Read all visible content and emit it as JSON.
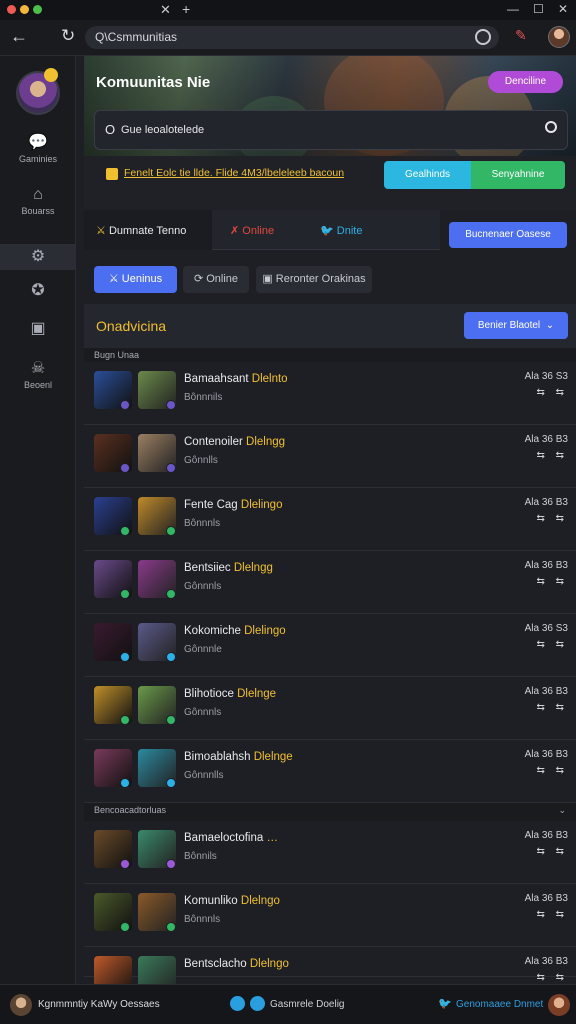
{
  "browser": {
    "url": "Q\\Csmmunitias",
    "tab_close": "✕",
    "tab_new": "+",
    "window_controls": [
      "—",
      "☐",
      "✕"
    ]
  },
  "sidebar": {
    "items": [
      {
        "icon": "chat-icon",
        "glyph": "💬",
        "label": "Gaminies"
      },
      {
        "icon": "home-icon",
        "glyph": "⌂",
        "label": "Bouarss"
      },
      {
        "icon": "gamepad-icon",
        "glyph": "⚙",
        "label": ""
      },
      {
        "icon": "controller-icon",
        "glyph": "✪",
        "label": ""
      },
      {
        "icon": "game-icon",
        "glyph": "▣",
        "label": ""
      },
      {
        "icon": "skull-icon",
        "glyph": "☠",
        "label": "Beoenl"
      }
    ]
  },
  "hero": {
    "title": "Komuunitas Nie",
    "button": "Denciline"
  },
  "search": {
    "text": "Gue leoalotelede"
  },
  "promo": {
    "text": "Fenelt Eolc tie llde. Flide 4M3/lbeleleeb bacoun",
    "btn_cyan": "Gealhinds",
    "btn_green": "Senyahnine"
  },
  "tabs": [
    {
      "label": "Dumnate Tenno",
      "icon": "sword-icon",
      "glyph": "⚔",
      "color": "#e8e9ec"
    },
    {
      "label": "Online",
      "icon": "flag-icon",
      "glyph": "✗",
      "color": "#e0483e"
    },
    {
      "label": "Dnite",
      "icon": "twitter-icon",
      "glyph": "🐦",
      "color": "#2bb0e8"
    }
  ],
  "cta_button": "Bucnenaer Oasese",
  "filters": [
    {
      "label": "Ueninus",
      "glyph": "⚔"
    },
    {
      "label": "Online",
      "glyph": "⟳"
    },
    {
      "label": "Reronter Orakinas",
      "glyph": "▣"
    }
  ],
  "section": {
    "title": "Onadvicina",
    "button": "Benier Blaotel"
  },
  "groups": [
    {
      "label": "Bugn Unaa"
    },
    {
      "label": "Bencoacadtorluas"
    }
  ],
  "rows": [
    {
      "name": "Bamaahsant",
      "tag": "Dlelnto",
      "sub": "Bônnnils",
      "time": "Ala 36 S3",
      "icons": "⇆ ⇆",
      "thumb_a": "#2b4f9a",
      "thumb_b": "#6b8a4a",
      "dot": "#6b56c8"
    },
    {
      "name": "Contenoiler",
      "tag": "Dlelngg",
      "sub": "Gônnlls",
      "time": "Ala 36 B3",
      "icons": "⇆ ⇆",
      "thumb_a": "#5a3020",
      "thumb_b": "#9b7f63",
      "dot": "#6b56c8"
    },
    {
      "name": "Fente Cag",
      "tag": "Dlelingo",
      "sub": "Bônnnls",
      "time": "Ala 36 B3",
      "icons": "⇆ ⇆",
      "thumb_a": "#2b4090",
      "thumb_b": "#c08a2a",
      "dot": "#31b766"
    },
    {
      "name": "Bentsiiec",
      "tag": "Dlelngg",
      "sub": "Gônnnls",
      "time": "Ala 36 B3",
      "icons": "⇆ ⇆",
      "thumb_a": "#6a4a8a",
      "thumb_b": "#8a3a8a",
      "dot": "#31b766"
    },
    {
      "name": "Kokomiche",
      "tag": "Dlelingo",
      "sub": "Gônnnle",
      "time": "Ala 36 S3",
      "icons": "⇆ ⇆",
      "thumb_a": "#3a1a30",
      "thumb_b": "#5a5a8a",
      "dot": "#2bb0e8"
    },
    {
      "name": "Blihotioce",
      "tag": "Dlelnge",
      "sub": "Gônnnls",
      "time": "Ala 36 B3",
      "icons": "⇆ ⇆",
      "thumb_a": "#c0902a",
      "thumb_b": "#6a9a4a",
      "dot": "#31b766"
    },
    {
      "name": "Bimoablahsh",
      "tag": "Dlelnge",
      "sub": "Gônnnlls",
      "time": "Ala 36 B3",
      "icons": "⇆ ⇆",
      "thumb_a": "#7a3a5a",
      "thumb_b": "#2a8aa0",
      "dot": "#2bb0e8"
    },
    {
      "name": "Bamaeloctofina",
      "tag": "…",
      "sub": "Bônnils",
      "time": "Ala 36 B3",
      "icons": "⇆ ⇆",
      "thumb_a": "#6a4a2a",
      "thumb_b": "#3a8a6a",
      "dot": "#9a5ad8"
    },
    {
      "name": "Komunliko",
      "tag": "Dlelngo",
      "sub": "Bônnnls",
      "time": "Ala 36 B3",
      "icons": "⇆ ⇆",
      "thumb_a": "#4a5a2a",
      "thumb_b": "#8a5a2a",
      "dot": "#31b766"
    },
    {
      "name": "Bentsclacho",
      "tag": "Dlelngo",
      "sub": "",
      "time": "Ala 36 B3",
      "icons": "⇆ ⇆",
      "thumb_a": "#c05a2a",
      "thumb_b": "#3a7a5a",
      "dot": "#2bb0e8"
    }
  ],
  "status_bar": {
    "left": "Kgnmmntiy KaWy Oessaes",
    "middle": "Gasmrele Doelig",
    "right": "Genomaaee Dnmet"
  },
  "colors": {
    "accent_blue": "#4c6ef0",
    "accent_yellow": "#f0c030",
    "hero_button": "#b04bd8",
    "cyan": "#2bb7e0",
    "green": "#31b766"
  }
}
